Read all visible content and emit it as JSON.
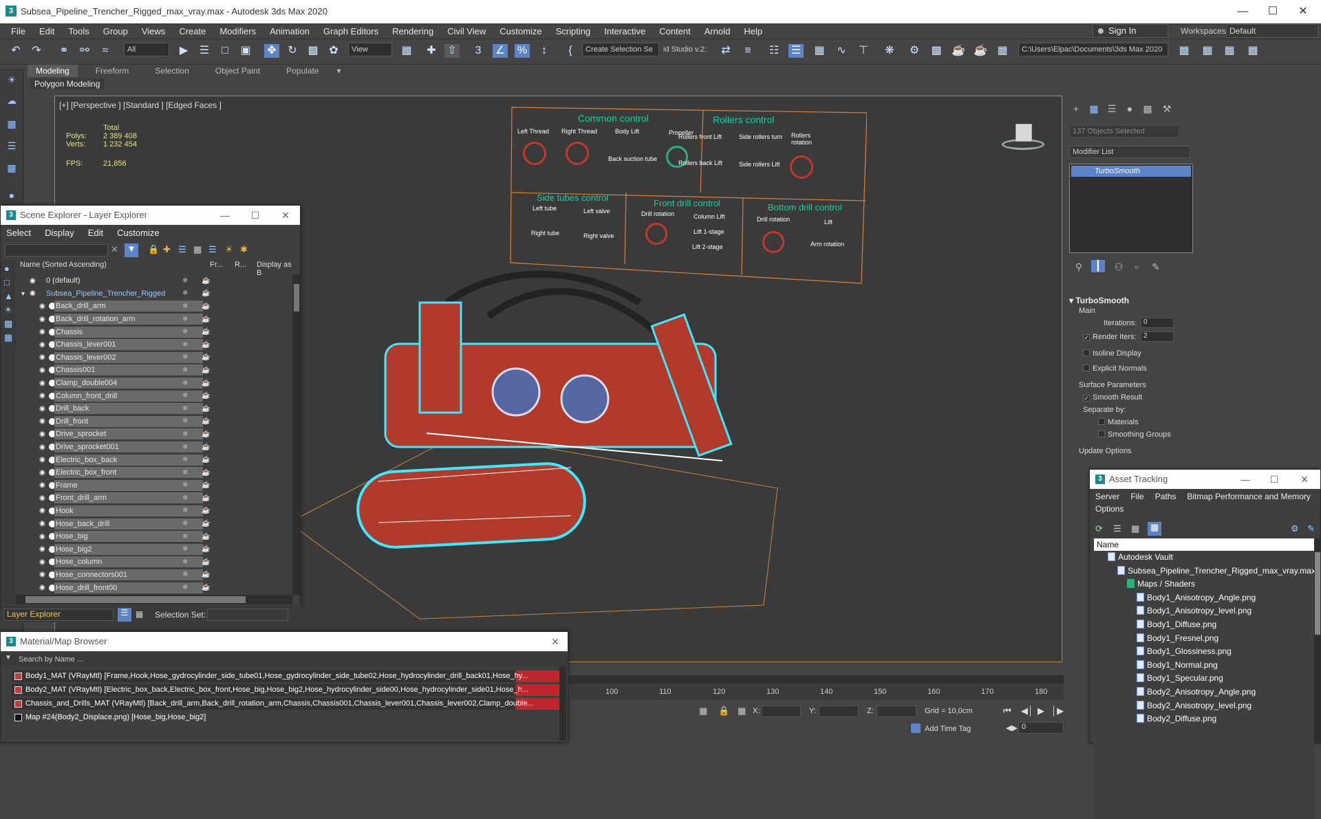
{
  "window": {
    "title": "Subsea_Pipeline_Trencher_Rigged_max_vray.max - Autodesk 3ds Max 2020"
  },
  "menu": [
    "File",
    "Edit",
    "Tools",
    "Group",
    "Views",
    "Create",
    "Modifiers",
    "Animation",
    "Graph Editors",
    "Rendering",
    "Civil View",
    "Customize",
    "Scripting",
    "Interactive",
    "Content",
    "Arnold",
    "Help"
  ],
  "account": {
    "sign_in": "Sign In",
    "workspaces_label": "Workspaces:",
    "workspace": "Default"
  },
  "toolbar": {
    "filter": "All",
    "view": "View",
    "selection_set": "Create Selection Se",
    "studio": "id Studio v.2:",
    "path": "C:\\Users\\Elpac\\Documents\\3ds Max 2020"
  },
  "ribbon": {
    "tabs": [
      "Modeling",
      "Freeform",
      "Selection",
      "Object Paint",
      "Populate"
    ],
    "active": "Modeling",
    "sub": "Polygon Modeling"
  },
  "viewport": {
    "label": "[+] [Perspective ] [Standard ] [Edged Faces ]",
    "total_label": "Total",
    "polys_label": "Polys:",
    "polys": "2 389 408",
    "verts_label": "Verts:",
    "verts": "1 232 454",
    "fps_label": "FPS:",
    "fps": "21,856",
    "panels": {
      "common": {
        "title": "Common control",
        "labels": [
          "Left Thread",
          "Right Thread",
          "Body Lift",
          "Propeller",
          "Back suction tube"
        ]
      },
      "rollers": {
        "title": "Rollers control",
        "labels": [
          "Rollers front Lift",
          "Side rollers turn",
          "Rollers rotation",
          "Rollers back Lift",
          "Side rollers Lift"
        ]
      },
      "side": {
        "title": "Side tubes control",
        "labels": [
          "Left tube",
          "Left valve",
          "Right tube",
          "Right valve"
        ]
      },
      "front": {
        "title": "Front drill control",
        "labels": [
          "Drill rotation",
          "Column Lift",
          "Lift 1-stage",
          "Lift 2-stage"
        ]
      },
      "bottom": {
        "title": "Bottom drill control",
        "labels": [
          "Drill rotation",
          "Lift",
          "Arm rotation"
        ]
      }
    }
  },
  "command_panel": {
    "objects_selected": "137 Objects Selected",
    "modifier_list": "Modifier List",
    "stack_item": "TurboSmooth",
    "turbosmooth": {
      "title": "TurboSmooth",
      "main": "Main",
      "iterations_label": "Iterations:",
      "iterations": "0",
      "render_iters_label": "Render Iters:",
      "render_iters": "2",
      "isoline": "Isoline Display",
      "explicit": "Explicit Normals",
      "surface": "Surface Parameters",
      "smooth_result": "Smooth Result",
      "separate": "Separate by:",
      "materials": "Materials",
      "smoothing_groups": "Smoothing Groups",
      "update": "Update Options"
    }
  },
  "layer_explorer": {
    "title": "Scene Explorer - Layer Explorer",
    "menu": [
      "Select",
      "Display",
      "Edit",
      "Customize"
    ],
    "columns": [
      "Name (Sorted Ascending)",
      "Fr...",
      "R...",
      "Display as B"
    ],
    "rows": [
      "0 (default)",
      "Subsea_Pipeline_Trencher_Rigged",
      "Back_drill_arm",
      "Back_drill_rotation_arm",
      "Chassis",
      "Chassis_lever001",
      "Chassis_lever002",
      "Chassis001",
      "Clamp_double004",
      "Column_front_drill",
      "Drill_back",
      "Drill_front",
      "Drive_sprocket",
      "Drive_sprocket001",
      "Electric_box_back",
      "Electric_box_front",
      "Frame",
      "Front_drill_arm",
      "Hook",
      "Hose_back_drill",
      "Hose_big",
      "Hose_big2",
      "Hose_column",
      "Hose_connectors001",
      "Hose_drill_front00"
    ],
    "bottom_label": "Layer Explorer",
    "selection_set_label": "Selection Set:"
  },
  "material_browser": {
    "title": "Material/Map Browser",
    "search": "Search by Name ...",
    "rows": [
      "Body1_MAT (VRayMtl) [Frame,Hook,Hose_gydrocylinder_side_tube01,Hose_gydrocylinder_side_tube02,Hose_hydrocylinder_drill_back01,Hose_hy...",
      "Body2_MAT (VRayMtl) [Electric_box_back,Electric_box_front,Hose_big,Hose_big2,Hose_hydrocylinder_side00,Hose_hydrocylinder_side01,Hose_h...",
      "Chassis_and_Drills_MAT (VRayMtl) [Back_drill_arm,Back_drill_rotation_arm,Chassis,Chassis001,Chassis_lever001,Chassis_lever002,Clamp_double...",
      "Map #24(Body2_Displace.png) [Hose_big,Hose_big2]"
    ]
  },
  "timeline": {
    "ticks": [
      "100",
      "110",
      "120",
      "130",
      "140",
      "150",
      "160",
      "170",
      "180"
    ]
  },
  "status": {
    "x": "X:",
    "y": "Y:",
    "z": "Z:",
    "grid": "Grid = 10,0cm",
    "add_time_tag": "Add Time Tag",
    "frame": "0"
  },
  "asset_tracking": {
    "title": "Asset Tracking",
    "menu": [
      "Server",
      "File",
      "Paths",
      "Bitmap Performance and Memory"
    ],
    "menu2": "Options",
    "column": "Name",
    "rows": [
      "Autodesk Vault",
      "Subsea_Pipeline_Trencher_Rigged_max_vray.max",
      "Maps / Shaders",
      "Body1_Anisotropy_Angle.png",
      "Body1_Anisotropy_level.png",
      "Body1_Diffuse.png",
      "Body1_Fresnel.png",
      "Body1_Glossiness.png",
      "Body1_Normal.png",
      "Body1_Specular.png",
      "Body2_Anisotropy_Angle.png",
      "Body2_Anisotropy_level.png",
      "Body2_Diffuse.png"
    ]
  },
  "colors": {
    "accent": "#5c84c8",
    "wire": "#c0392b",
    "outline": "#3ee8ff",
    "panel_text": "#00d8a0"
  }
}
